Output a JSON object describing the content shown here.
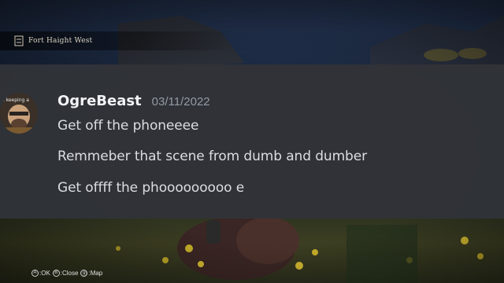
{
  "hud": {
    "location": "Fort Haight West",
    "location_icon": "map-marker-icon"
  },
  "message": {
    "avatar_caption": "a keeping a",
    "username": "OgreBeast",
    "timestamp": "03/11/2022",
    "lines": [
      "Get off the phoneeee",
      "Remmeber that scene from dumb and dumber",
      "Get offff the phooooooooo e"
    ]
  },
  "controls": [
    {
      "glyph": "A",
      "label": ":OK"
    },
    {
      "glyph": "B",
      "label": ":Close"
    },
    {
      "glyph": "Ⓡ",
      "label": ":Map"
    }
  ],
  "colors": {
    "panel": "#313338",
    "username": "#f2f3f5",
    "timestamp": "#949ba4",
    "message_text": "#dbdee1"
  }
}
